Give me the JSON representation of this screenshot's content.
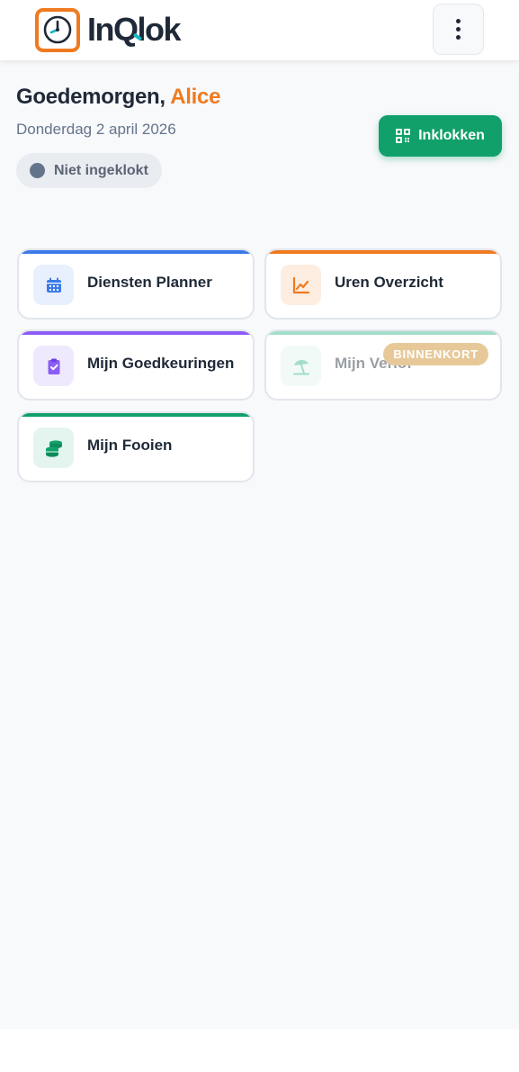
{
  "header": {
    "brand": "InQlok",
    "menu_icon": "more-vertical-icon"
  },
  "greeting": {
    "prefix": "Goedemorgen, ",
    "name": "Alice",
    "date": "Donderdag 2 april 2026"
  },
  "status": {
    "label": "Niet ingeklokt"
  },
  "clockin": {
    "label": "Inklokken",
    "icon": "qr-code-icon"
  },
  "tiles": [
    {
      "label": "Diensten Planner",
      "icon": "calendar-icon",
      "accent": "#3b7be8",
      "tint": "#e8f0fd",
      "disabled": false
    },
    {
      "label": "Uren Overzicht",
      "icon": "chart-line-icon",
      "accent": "#f07a1f",
      "tint": "#fdece0",
      "disabled": false
    },
    {
      "label": "Mijn Goedkeuringen",
      "icon": "clipboard-check-icon",
      "accent": "#8b5cf6",
      "tint": "#efe9fe",
      "disabled": false
    },
    {
      "label": "Mijn Verlof",
      "icon": "beach-umbrella-icon",
      "accent": "#34b58a",
      "tint": "#e3f5ee",
      "disabled": true,
      "badge": "BINNENKORT"
    },
    {
      "label": "Mijn Fooien",
      "icon": "coins-icon",
      "accent": "#12a06a",
      "tint": "#e3f5ee",
      "disabled": false
    }
  ],
  "colors": {
    "brand_orange": "#f07a1f",
    "brand_green": "#12a06a",
    "status_gray": "#64748b"
  }
}
